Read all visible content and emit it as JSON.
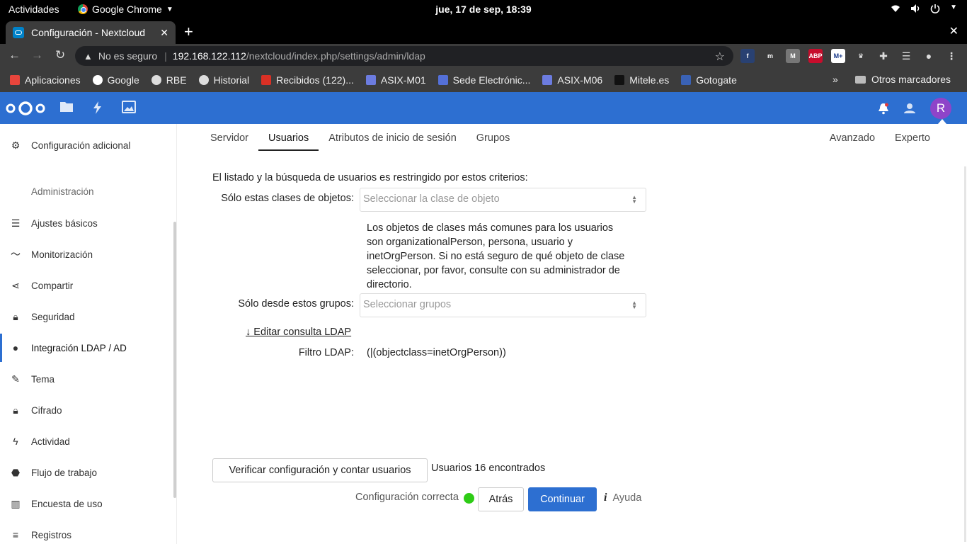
{
  "os_bar": {
    "activities": "Actividades",
    "app_name": "Google Chrome",
    "clock": "jue, 17 de sep, 18:39"
  },
  "browser": {
    "tab_title": "Configuración - Nextcloud",
    "security_label": "No es seguro",
    "url_host": "192.168.122.112",
    "url_path": "/nextcloud/index.php/settings/admin/ldap",
    "extensions": [
      {
        "name": "fedora",
        "label": "f",
        "color": "#294172"
      },
      {
        "name": "m-ghost",
        "label": "m",
        "color": "#3c3c3c"
      },
      {
        "name": "m-grey",
        "label": "M",
        "color": "#777777"
      },
      {
        "name": "adblock",
        "label": "ABP",
        "color": "#c70d2c"
      },
      {
        "name": "movistar",
        "label": "M+",
        "color": "#ffffff"
      },
      {
        "name": "crown",
        "label": "♛",
        "color": "#3c3c3c"
      }
    ],
    "bookmarks": [
      {
        "label": "Aplicaciones",
        "icon": "apps-grid-icon",
        "color": "#e8453c"
      },
      {
        "label": "Google",
        "icon": "google-icon",
        "color": "#ffffff"
      },
      {
        "label": "RBE",
        "icon": "globe-icon",
        "color": "#dddddd"
      },
      {
        "label": "Historial",
        "icon": "globe-icon",
        "color": "#dddddd"
      },
      {
        "label": "Recibidos (122)...",
        "icon": "gmail-icon",
        "color": "#d93025"
      },
      {
        "label": "ASIX-M01",
        "icon": "moodle-icon",
        "color": "#6c7ce0"
      },
      {
        "label": "Sede Electrónic...",
        "icon": "sede-icon",
        "color": "#5470d8"
      },
      {
        "label": "ASIX-M06",
        "icon": "moodle-icon",
        "color": "#6c7ce0"
      },
      {
        "label": "Mitele.es",
        "icon": "mitele-icon",
        "color": "#111111"
      },
      {
        "label": "Gotogate",
        "icon": "gotogate-icon",
        "color": "#3a62b5"
      }
    ],
    "more_bookmarks": "»",
    "other_bookmarks": "Otros marcadores"
  },
  "nextcloud": {
    "accent": "#2d6fd1",
    "avatar_letter": "R"
  },
  "sidebar": {
    "top_item": {
      "label": "Configuración adicional",
      "icon": "gear-icon"
    },
    "section_caption": "Administración",
    "items": [
      {
        "label": "Ajustes básicos",
        "icon": "list-icon"
      },
      {
        "label": "Monitorización",
        "icon": "pulse-icon"
      },
      {
        "label": "Compartir",
        "icon": "share-icon"
      },
      {
        "label": "Seguridad",
        "icon": "lock-icon"
      },
      {
        "label": "Integración LDAP / AD",
        "icon": "user-icon"
      },
      {
        "label": "Tema",
        "icon": "brush-icon"
      },
      {
        "label": "Cifrado",
        "icon": "lock-icon"
      },
      {
        "label": "Actividad",
        "icon": "bolt-icon"
      },
      {
        "label": "Flujo de trabajo",
        "icon": "tag-icon"
      },
      {
        "label": "Encuesta de uso",
        "icon": "chart-icon"
      },
      {
        "label": "Registros",
        "icon": "logs-icon"
      }
    ]
  },
  "ldap": {
    "tabs": [
      "Servidor",
      "Usuarios",
      "Atributos de inicio de sesión",
      "Grupos"
    ],
    "active_tab": "Usuarios",
    "right_tabs": [
      "Avanzado",
      "Experto"
    ],
    "intro": "El listado y la búsqueda de usuarios es restringido por estos criterios:",
    "object_classes_label": "Sólo estas clases de objetos:",
    "object_classes_placeholder": "Seleccionar la clase de objeto",
    "hint": "Los objetos de clases más comunes para los usuarios son organizationalPerson, persona, usuario y inetOrgPerson. Si no está seguro de qué objeto de clase seleccionar, por favor, consulte con su administrador de directorio.",
    "groups_label": "Sólo desde estos grupos:",
    "groups_placeholder": "Seleccionar grupos",
    "edit_query_link": "↓ Editar consulta LDAP",
    "filter_label": "Filtro LDAP:",
    "filter_value": "(|(objectclass=inetOrgPerson))",
    "verify_button": "Verificar configuración y contar usuarios",
    "count_text": "Usuarios 16 encontrados",
    "status_text": "Configuración correcta",
    "status_color": "#2ecc16",
    "back_button": "Atrás",
    "continue_button": "Continuar",
    "help_label": "Ayuda"
  }
}
